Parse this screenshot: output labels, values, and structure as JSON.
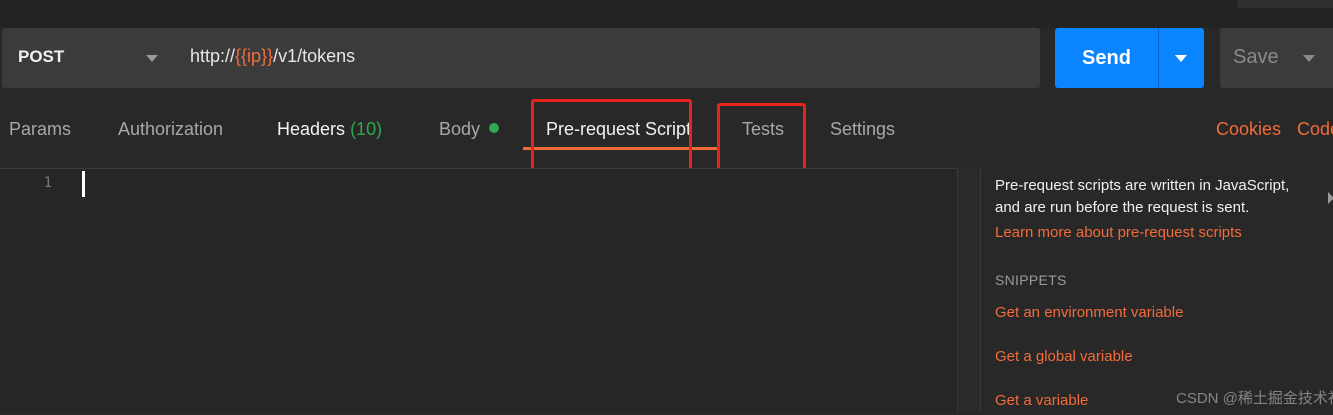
{
  "request": {
    "method": "POST",
    "url_prefix": "http://",
    "url_variable": "{{ip}}",
    "url_suffix": "/v1/tokens"
  },
  "send": {
    "label": "Send"
  },
  "save": {
    "label": "Save"
  },
  "tabs": [
    {
      "label": "Params"
    },
    {
      "label": "Authorization"
    },
    {
      "label": "Headers",
      "count": "(10)"
    },
    {
      "label": "Body"
    },
    {
      "label": "Pre-request Script"
    },
    {
      "label": "Tests"
    },
    {
      "label": "Settings"
    }
  ],
  "links": {
    "cookies": "Cookies",
    "code": "Code"
  },
  "editor": {
    "line_number": "1"
  },
  "panel": {
    "description": "Pre-request scripts are written in JavaScript, and are run before the request is sent.",
    "learn_more": "Learn more about pre-request scripts",
    "snippets_heading": "SNIPPETS",
    "snippets": [
      "Get an environment variable",
      "Get a global variable",
      "Get a variable"
    ]
  },
  "watermark": "CSDN @稀土掘金技术社区",
  "colors": {
    "accent": "#f26b3a",
    "send": "#0a84ff",
    "highlight": "#e8221c",
    "success": "#2fa84f"
  }
}
